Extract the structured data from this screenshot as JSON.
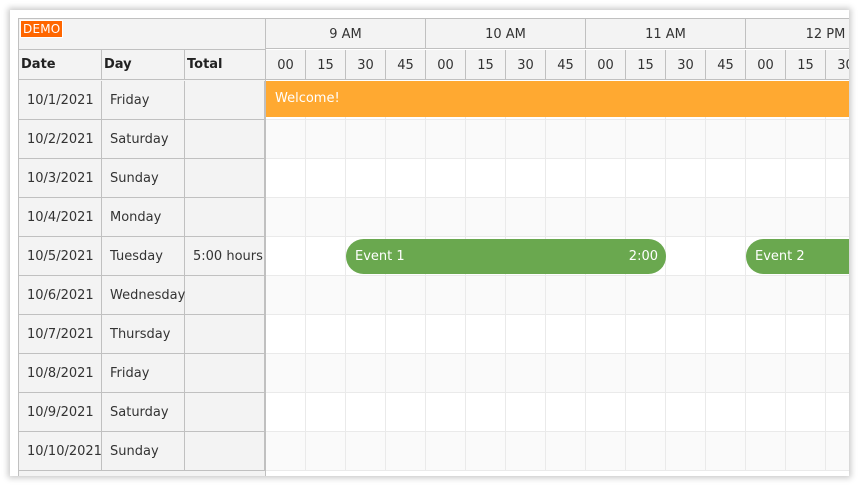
{
  "demo_badge": "DEMO",
  "headers": {
    "date": "Date",
    "day": "Day",
    "total": "Total"
  },
  "hours": [
    "9 AM",
    "10 AM",
    "11 AM",
    "12 PM"
  ],
  "minutes": [
    "00",
    "15",
    "30",
    "45",
    "00",
    "15",
    "30",
    "45",
    "00",
    "15",
    "30",
    "45",
    "00",
    "15",
    "30"
  ],
  "rows": [
    {
      "date": "10/1/2021",
      "day": "Friday",
      "total": ""
    },
    {
      "date": "10/2/2021",
      "day": "Saturday",
      "total": ""
    },
    {
      "date": "10/3/2021",
      "day": "Sunday",
      "total": ""
    },
    {
      "date": "10/4/2021",
      "day": "Monday",
      "total": ""
    },
    {
      "date": "10/5/2021",
      "day": "Tuesday",
      "total": "5:00 hours"
    },
    {
      "date": "10/6/2021",
      "day": "Wednesday",
      "total": ""
    },
    {
      "date": "10/7/2021",
      "day": "Thursday",
      "total": ""
    },
    {
      "date": "10/8/2021",
      "day": "Friday",
      "total": ""
    },
    {
      "date": "10/9/2021",
      "day": "Saturday",
      "total": ""
    },
    {
      "date": "10/10/2021",
      "day": "Sunday",
      "total": ""
    }
  ],
  "events": [
    {
      "text": "Welcome!",
      "duration": "",
      "color": "#ffa931",
      "row": 0,
      "start": "9:00 AM"
    },
    {
      "text": "Event 1",
      "duration": "2:00",
      "color": "#6aa84f",
      "row": 4,
      "start": "9:30 AM",
      "end": "11:30 AM"
    },
    {
      "text": "Event 2",
      "duration": "",
      "color": "#6aa84f",
      "row": 4,
      "start": "12:00 PM"
    }
  ],
  "colors": {
    "header_bg": "#f3f3f3",
    "demo_bg": "#ff6600",
    "orange_event": "#ffa931",
    "green_event": "#6aa84f"
  }
}
